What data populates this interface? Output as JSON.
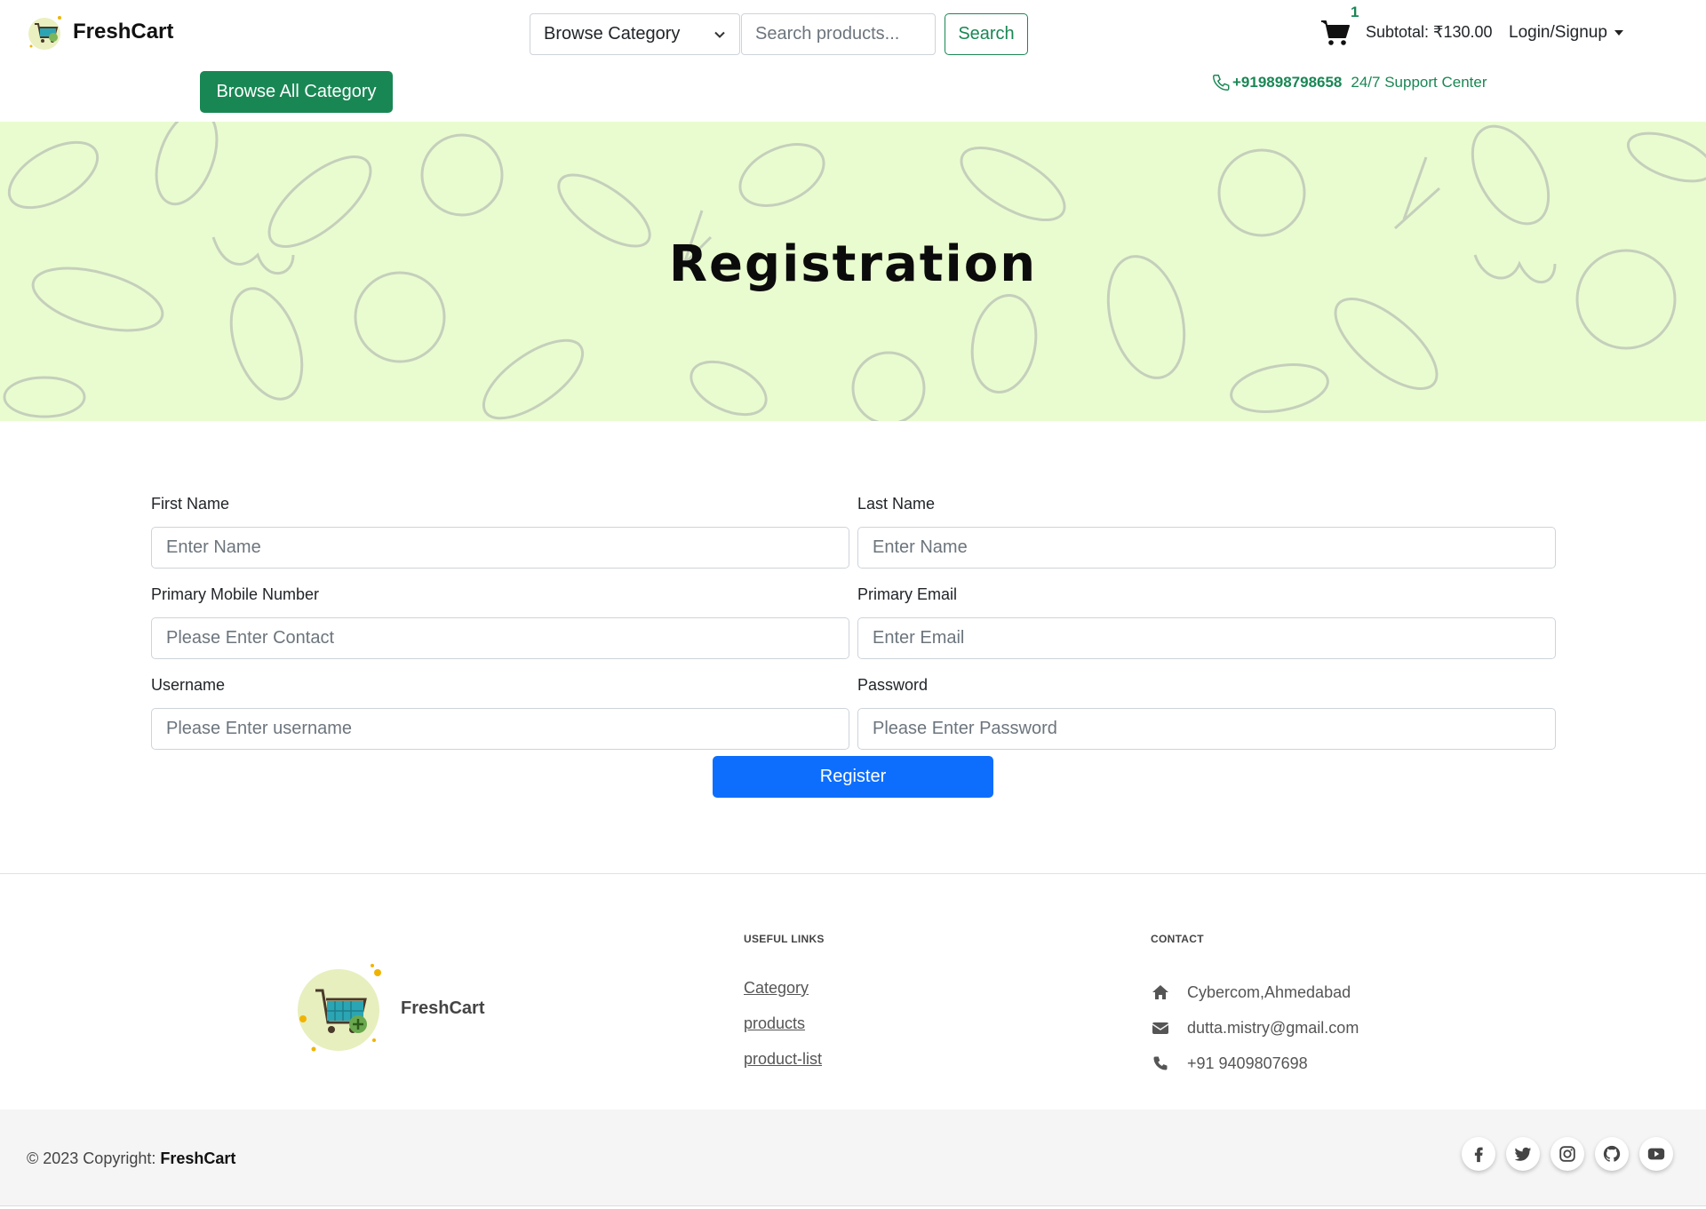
{
  "header": {
    "logo_text": "FreshCart",
    "category_select": "Browse Category",
    "search_placeholder": "Search products...",
    "search_button": "Search",
    "cart_count": "1",
    "subtotal": "Subtotal: ₹130.00",
    "login": "Login/Signup",
    "browse_all": "Browse All Category",
    "support_phone": "+919898798658",
    "support_text": "24/7 Support Center"
  },
  "banner": {
    "title": "Registration",
    "background_color": "#e9fcd0"
  },
  "form": {
    "first_name_label": "First Name",
    "first_name_placeholder": "Enter Name",
    "last_name_label": "Last Name",
    "last_name_placeholder": "Enter Name",
    "mobile_label": "Primary Mobile Number",
    "mobile_placeholder": "Please Enter Contact",
    "email_label": "Primary Email",
    "email_placeholder": "Enter Email",
    "username_label": "Username",
    "username_placeholder": "Please Enter username",
    "password_label": "Password",
    "password_placeholder": "Please Enter Password",
    "register_button": "Register"
  },
  "footer": {
    "brand": "FreshCart",
    "useful_links_title": "USEFUL LINKS",
    "links": [
      "Category",
      "products",
      "product-list"
    ],
    "contact_title": "CONTACT",
    "address": "Cybercom,Ahmedabad",
    "email": "dutta.mistry@gmail.com",
    "phone": "+91 9409807698",
    "copyright_prefix": "© 2023 Copyright: ",
    "copyright_brand": "FreshCart",
    "socials": [
      "facebook-icon",
      "twitter-icon",
      "instagram-icon",
      "github-icon",
      "youtube-icon"
    ]
  },
  "colors": {
    "brand_green": "#198754",
    "primary_blue": "#0d6efd",
    "banner_bg": "#e9fcd0"
  }
}
